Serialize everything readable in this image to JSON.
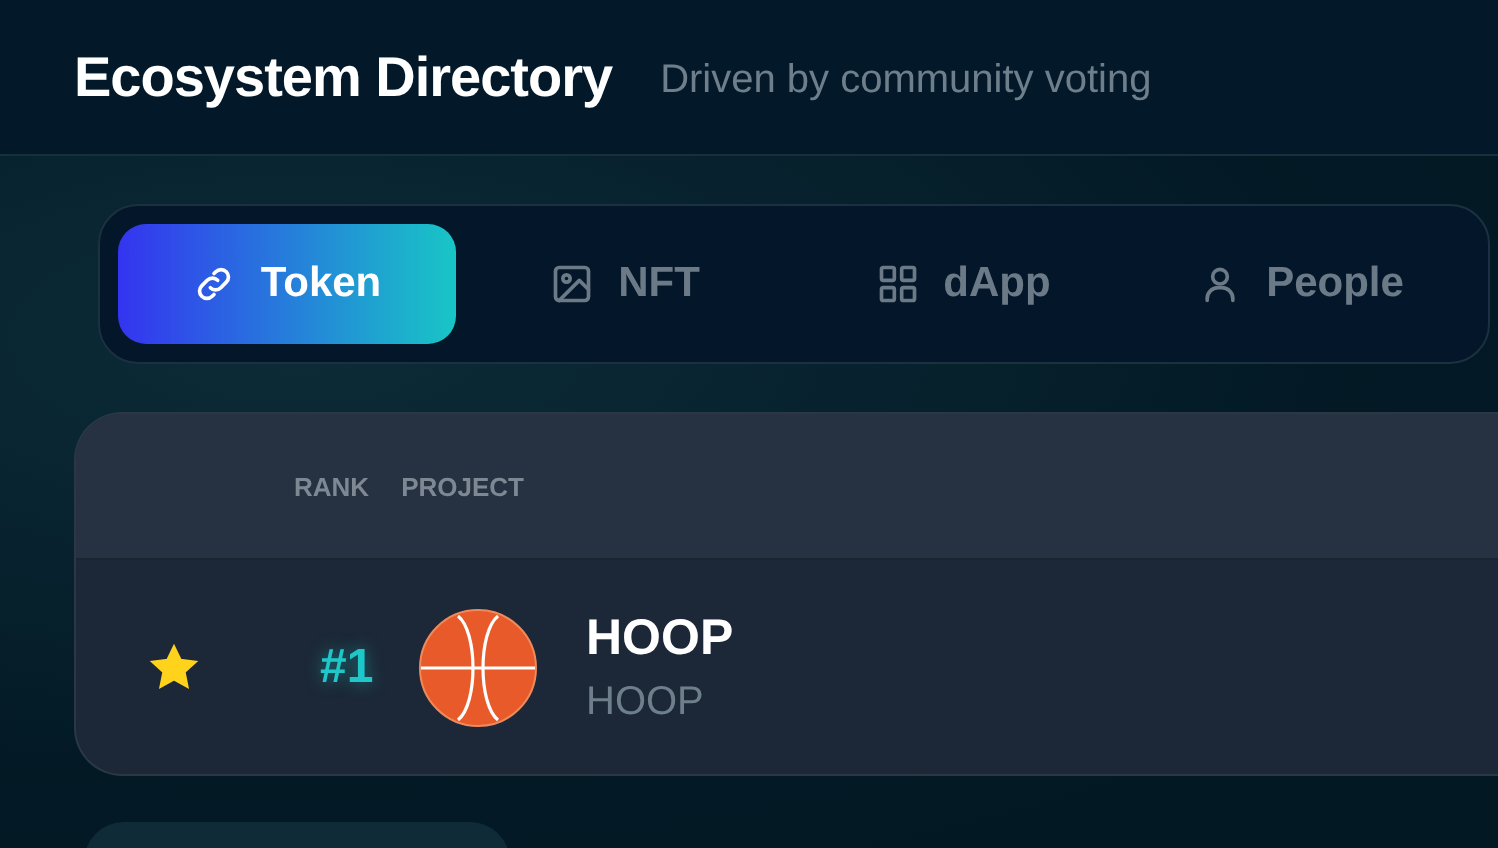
{
  "header": {
    "title": "Ecosystem Directory",
    "subtitle": "Driven by community voting"
  },
  "tabs": [
    {
      "label": "Token",
      "selected": true
    },
    {
      "label": "NFT",
      "selected": false
    },
    {
      "label": "dApp",
      "selected": false
    },
    {
      "label": "People",
      "selected": false
    }
  ],
  "table": {
    "columns": [
      "RANK",
      "PROJECT"
    ],
    "rows": [
      {
        "favorite": true,
        "rank": "#1",
        "name": "HOOP",
        "symbol": "HOOP"
      }
    ]
  }
}
